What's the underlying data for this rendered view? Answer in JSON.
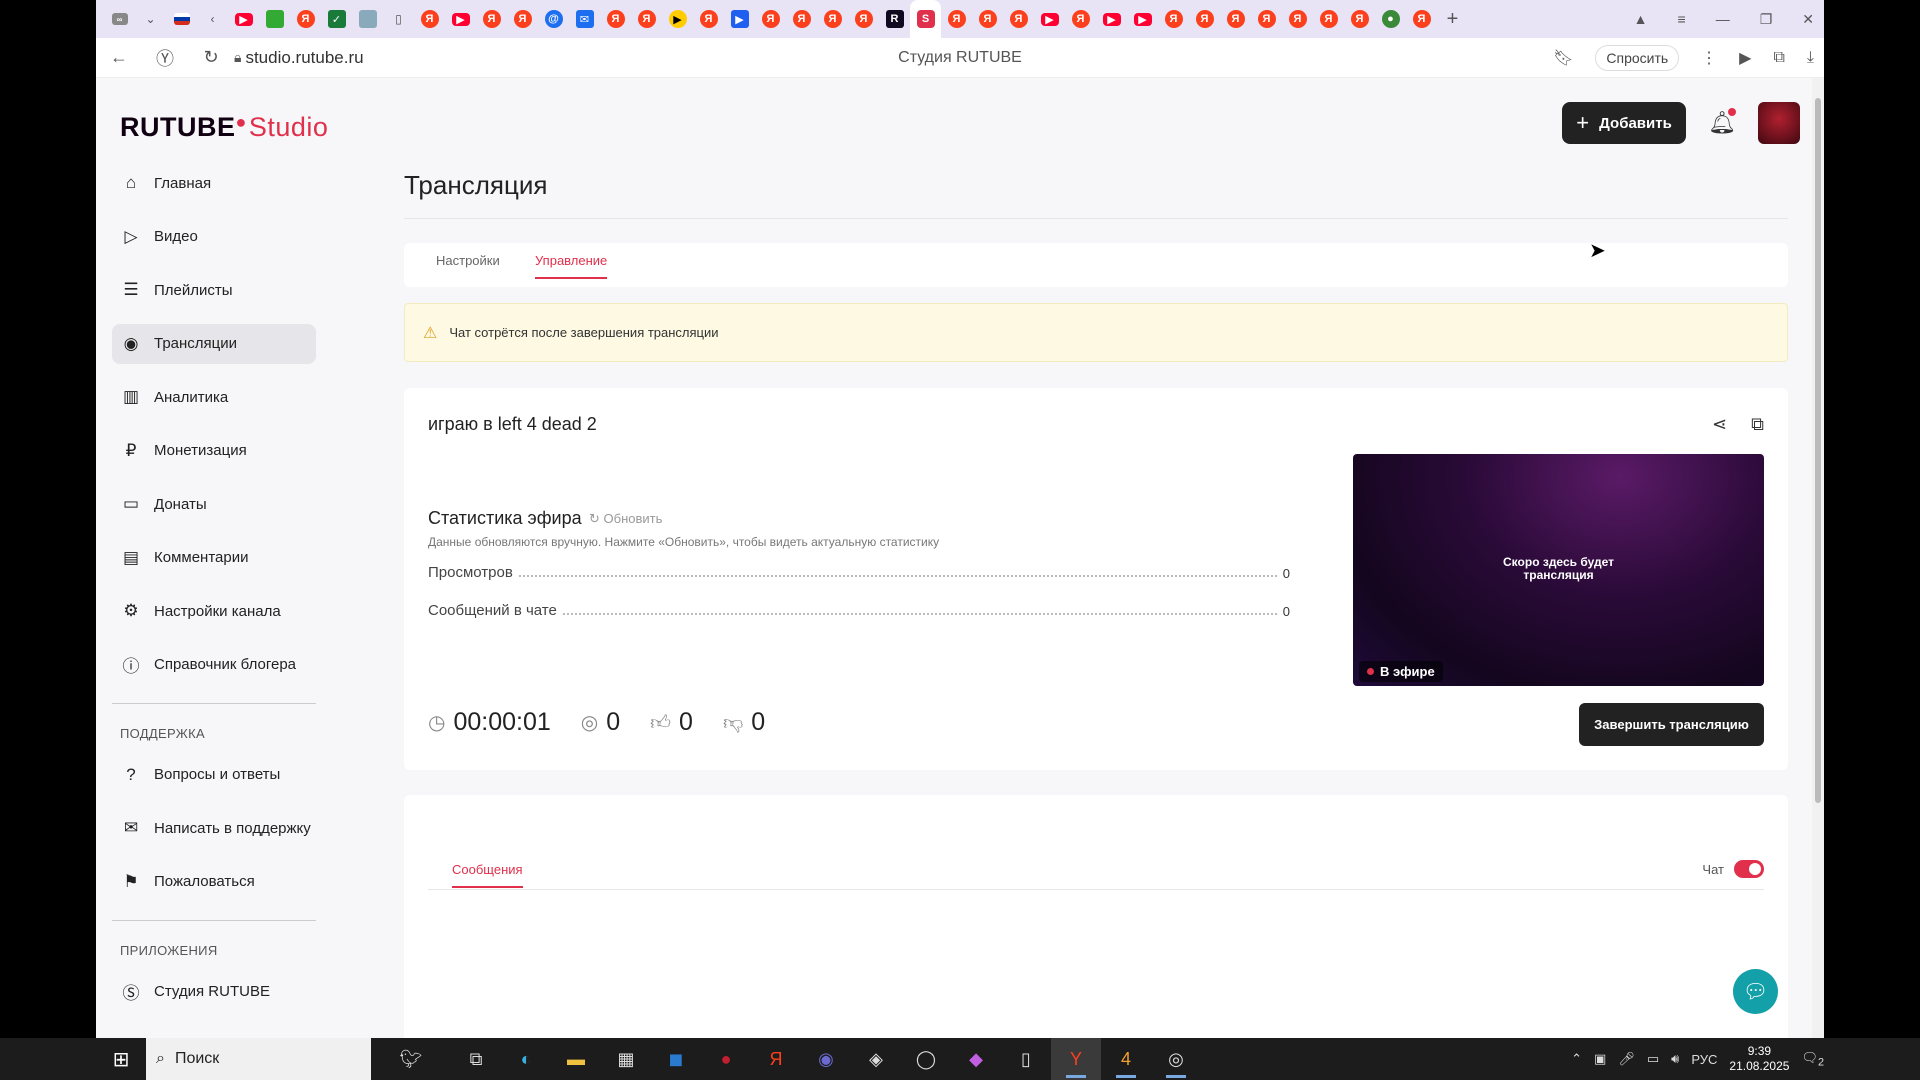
{
  "browser": {
    "url": "studio.rutube.ru",
    "page_title": "Студия RUTUBE",
    "ask_label": "Спросить",
    "colors": {
      "tabstrip": "#e8e3f5"
    }
  },
  "app": {
    "logo_main": "RUTUBE",
    "logo_studio": "Studio",
    "add_button": "Добавить",
    "brand_color": "#e0304c"
  },
  "sidebar": {
    "items": [
      {
        "label": "Главная",
        "icon": "home-icon"
      },
      {
        "label": "Видео",
        "icon": "video-icon"
      },
      {
        "label": "Плейлисты",
        "icon": "playlist-icon"
      },
      {
        "label": "Трансляции",
        "icon": "broadcast-icon"
      },
      {
        "label": "Аналитика",
        "icon": "analytics-icon"
      },
      {
        "label": "Монетизация",
        "icon": "ruble-icon"
      },
      {
        "label": "Донаты",
        "icon": "wallet-icon"
      },
      {
        "label": "Комментарии",
        "icon": "comment-icon"
      },
      {
        "label": "Настройки канала",
        "icon": "gear-icon"
      },
      {
        "label": "Справочник блогера",
        "icon": "info-icon"
      }
    ],
    "support_heading": "ПОДДЕРЖКА",
    "support_items": [
      {
        "label": "Вопросы и ответы",
        "icon": "question-icon"
      },
      {
        "label": "Написать в поддержку",
        "icon": "mail-icon"
      },
      {
        "label": "Пожаловаться",
        "icon": "flag-icon"
      }
    ],
    "apps_heading": "ПРИЛОЖЕНИЯ",
    "apps_items": [
      {
        "label": "Студия RUTUBE",
        "icon": "studio-icon"
      }
    ]
  },
  "main": {
    "heading": "Трансляция",
    "tabs": [
      {
        "label": "Настройки",
        "selected": false
      },
      {
        "label": "Управление",
        "selected": true
      }
    ],
    "warning": "Чат сотрётся после завершения трансляции",
    "stream_title": "играю в left 4 dead 2",
    "stats_heading": "Статистика эфира",
    "refresh_label": "Обновить",
    "stats_note": "Данные обновляются вручную. Нажмите «Обновить», чтобы видеть актуальную статистику",
    "stats": [
      {
        "label": "Просмотров",
        "value": "0"
      },
      {
        "label": "Сообщений в чате",
        "value": "0"
      }
    ],
    "timer": "00:00:01",
    "viewers": "0",
    "likes": "0",
    "dislikes": "0",
    "preview_text_1": "Скоро здесь будет",
    "preview_text_2": "трансляция",
    "live_badge": "В эфире",
    "end_button": "Завершить трансляцию",
    "chat_tab": "Сообщения",
    "chat_toggle_label": "Чат",
    "chat_enabled": true
  },
  "taskbar": {
    "search_placeholder": "Поиск",
    "lang": "РУС",
    "time": "9:39",
    "date": "21.08.2025",
    "notification_count": "2"
  }
}
